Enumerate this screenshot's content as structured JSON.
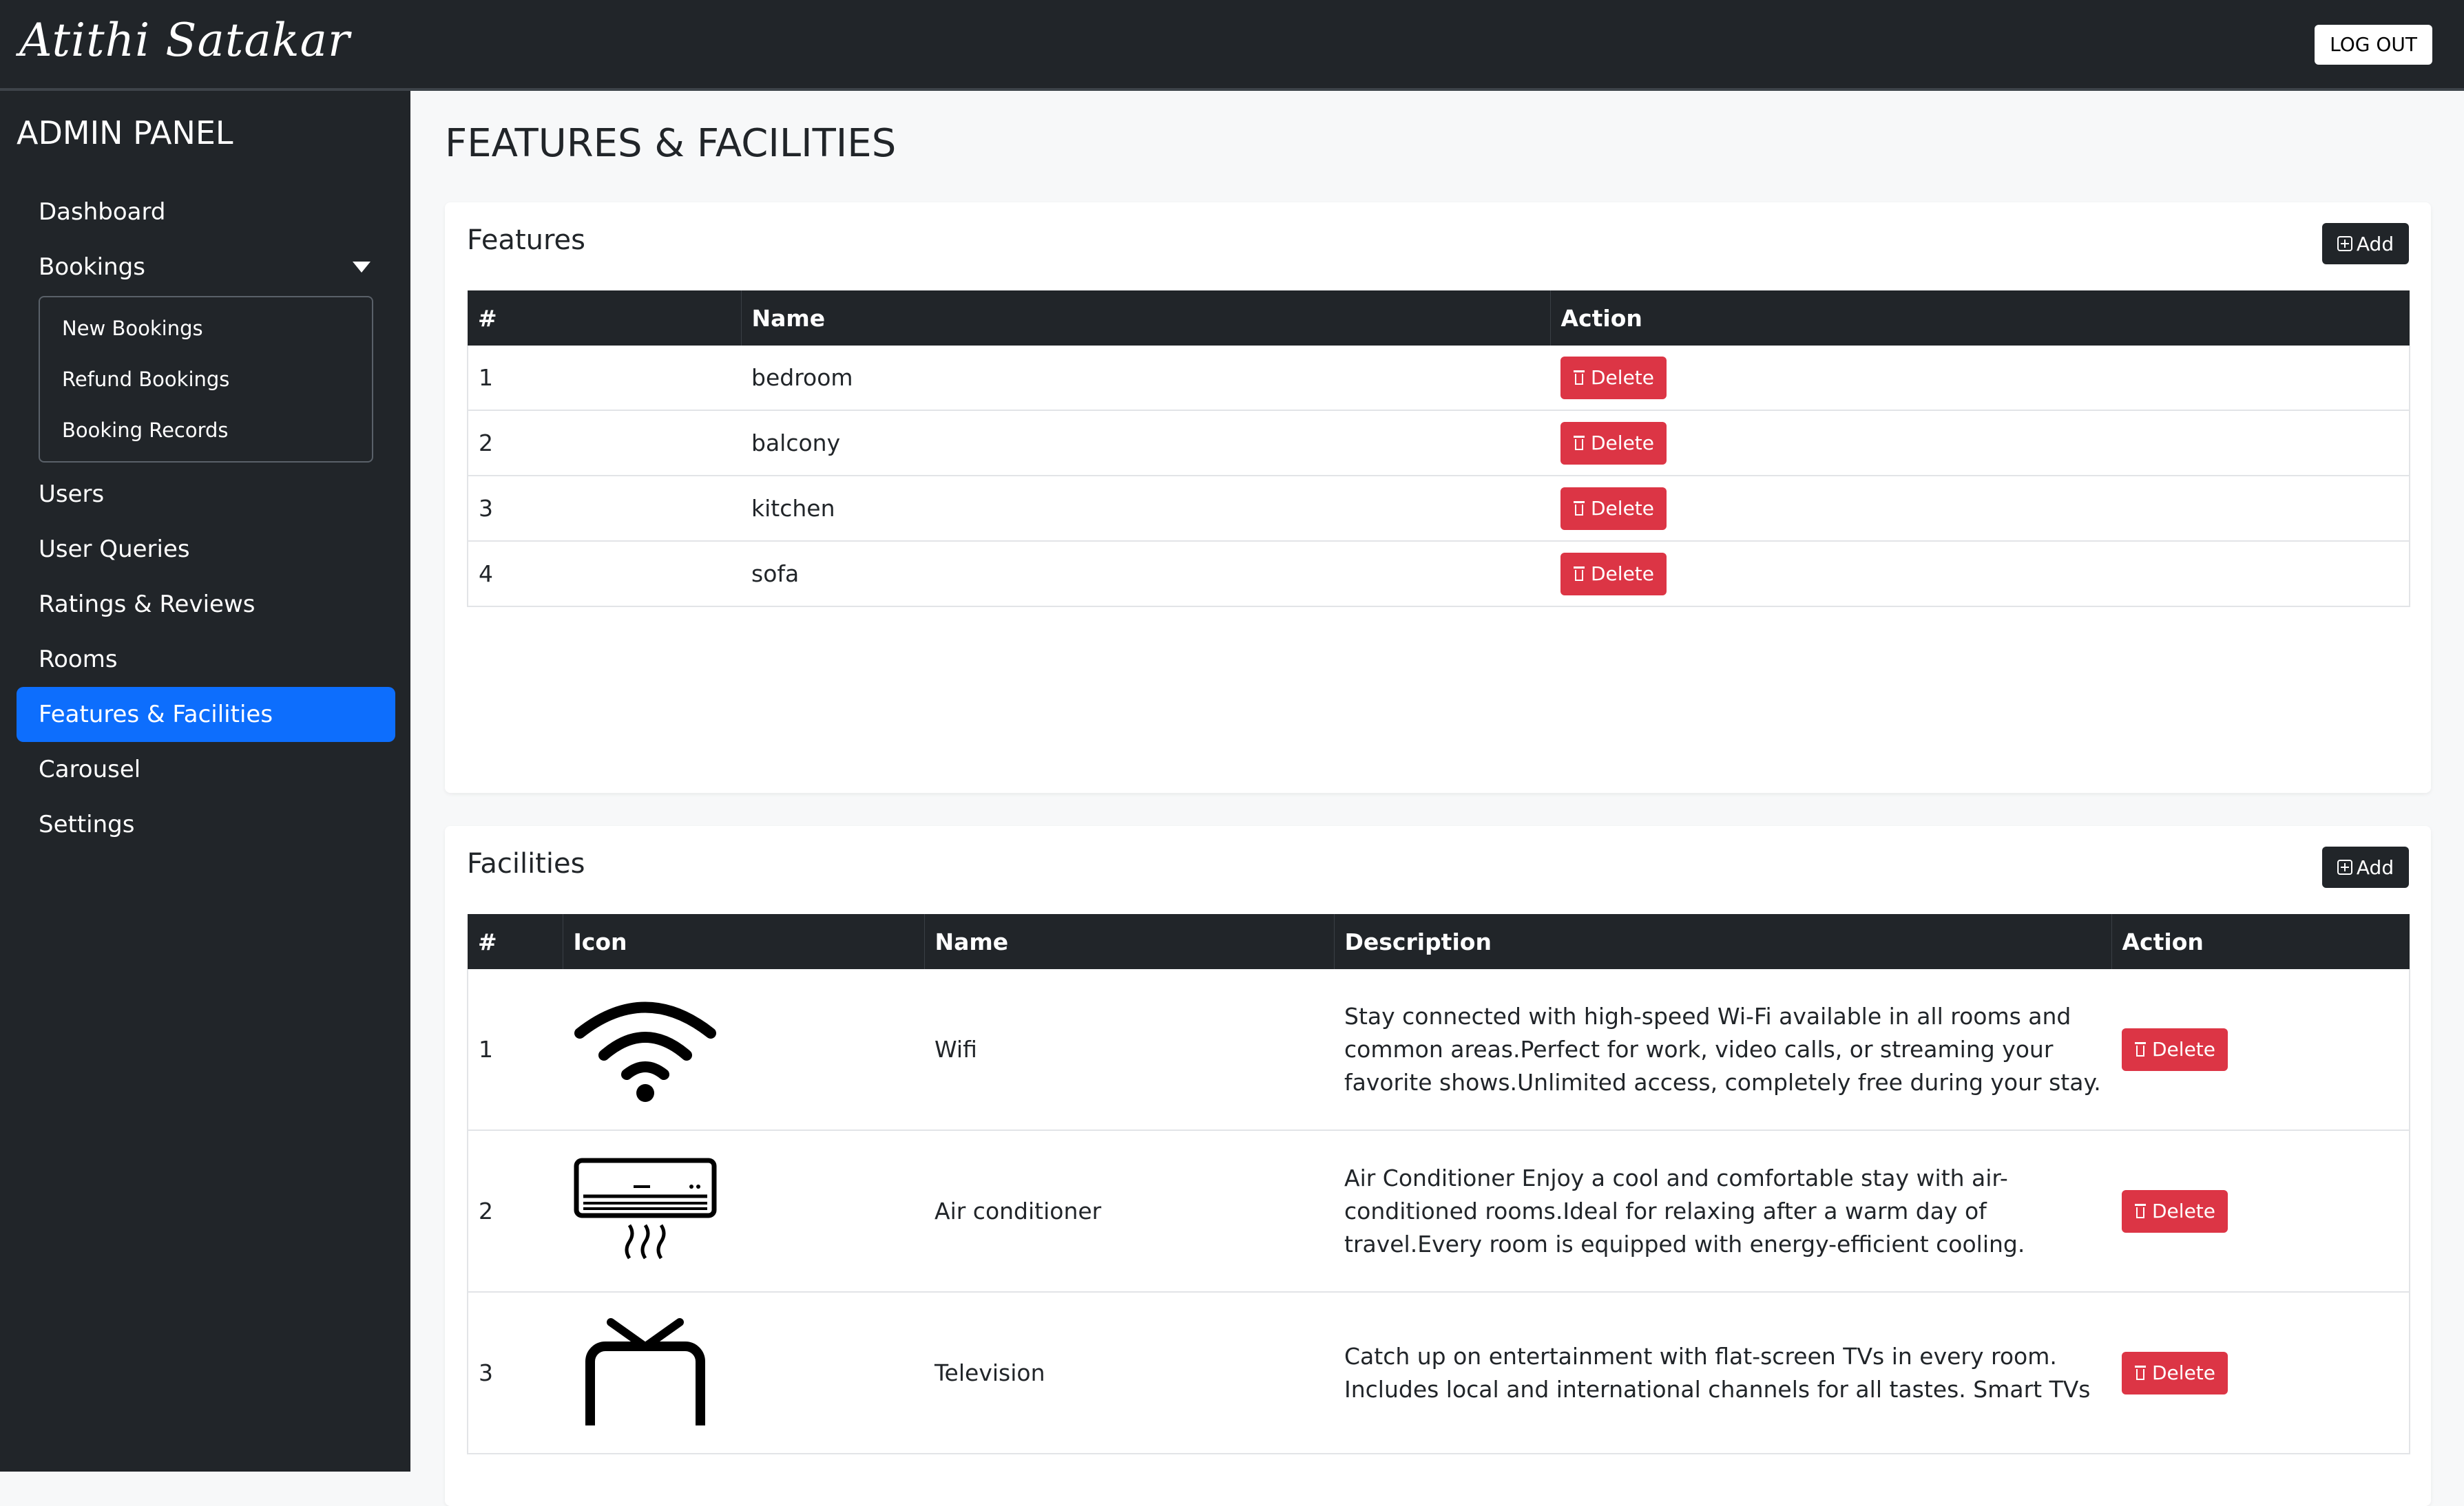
{
  "app": {
    "brand": "Atithi Satakar",
    "logout_label": "LOG OUT"
  },
  "sidebar": {
    "title": "ADMIN PANEL",
    "items": [
      {
        "label": "Dashboard"
      },
      {
        "label": "Bookings"
      },
      {
        "label": "Users"
      },
      {
        "label": "User Queries"
      },
      {
        "label": "Ratings & Reviews"
      },
      {
        "label": "Rooms"
      },
      {
        "label": "Features & Facilities"
      },
      {
        "label": "Carousel"
      },
      {
        "label": "Settings"
      }
    ],
    "bookings_sub": [
      "New Bookings",
      "Refund Bookings",
      "Booking Records"
    ],
    "active_color": "#0d6efd"
  },
  "page": {
    "title": "FEATURES & FACILITIES"
  },
  "features": {
    "title": "Features",
    "add_label": "Add",
    "columns": [
      "#",
      "Name",
      "Action"
    ],
    "rows": [
      {
        "num": "1",
        "name": "bedroom"
      },
      {
        "num": "2",
        "name": "balcony"
      },
      {
        "num": "3",
        "name": "kitchen"
      },
      {
        "num": "4",
        "name": "sofa"
      }
    ]
  },
  "facilities": {
    "title": "Facilities",
    "add_label": "Add",
    "columns": [
      "#",
      "Icon",
      "Name",
      "Description",
      "Action"
    ],
    "rows": [
      {
        "num": "1",
        "icon": "wifi-icon",
        "name": "Wifi",
        "description": "Stay connected with high-speed Wi-Fi available in all rooms and common areas.Perfect for work, video calls, or streaming your favorite shows.Unlimited access, completely free during your stay."
      },
      {
        "num": "2",
        "icon": "air-conditioner-icon",
        "name": "Air conditioner",
        "description": "Air Conditioner Enjoy a cool and comfortable stay with air-conditioned rooms.Ideal for relaxing after a warm day of travel.Every room is equipped with energy-efficient cooling."
      },
      {
        "num": "3",
        "icon": "television-icon",
        "name": "Television",
        "description": "Catch up on entertainment with flat-screen TVs in every room. Includes local and international channels for all tastes. Smart TVs"
      }
    ]
  },
  "delete_label": "Delete",
  "colors": {
    "dark": "#212529",
    "danger": "#dc3545",
    "primary": "#0d6efd"
  }
}
